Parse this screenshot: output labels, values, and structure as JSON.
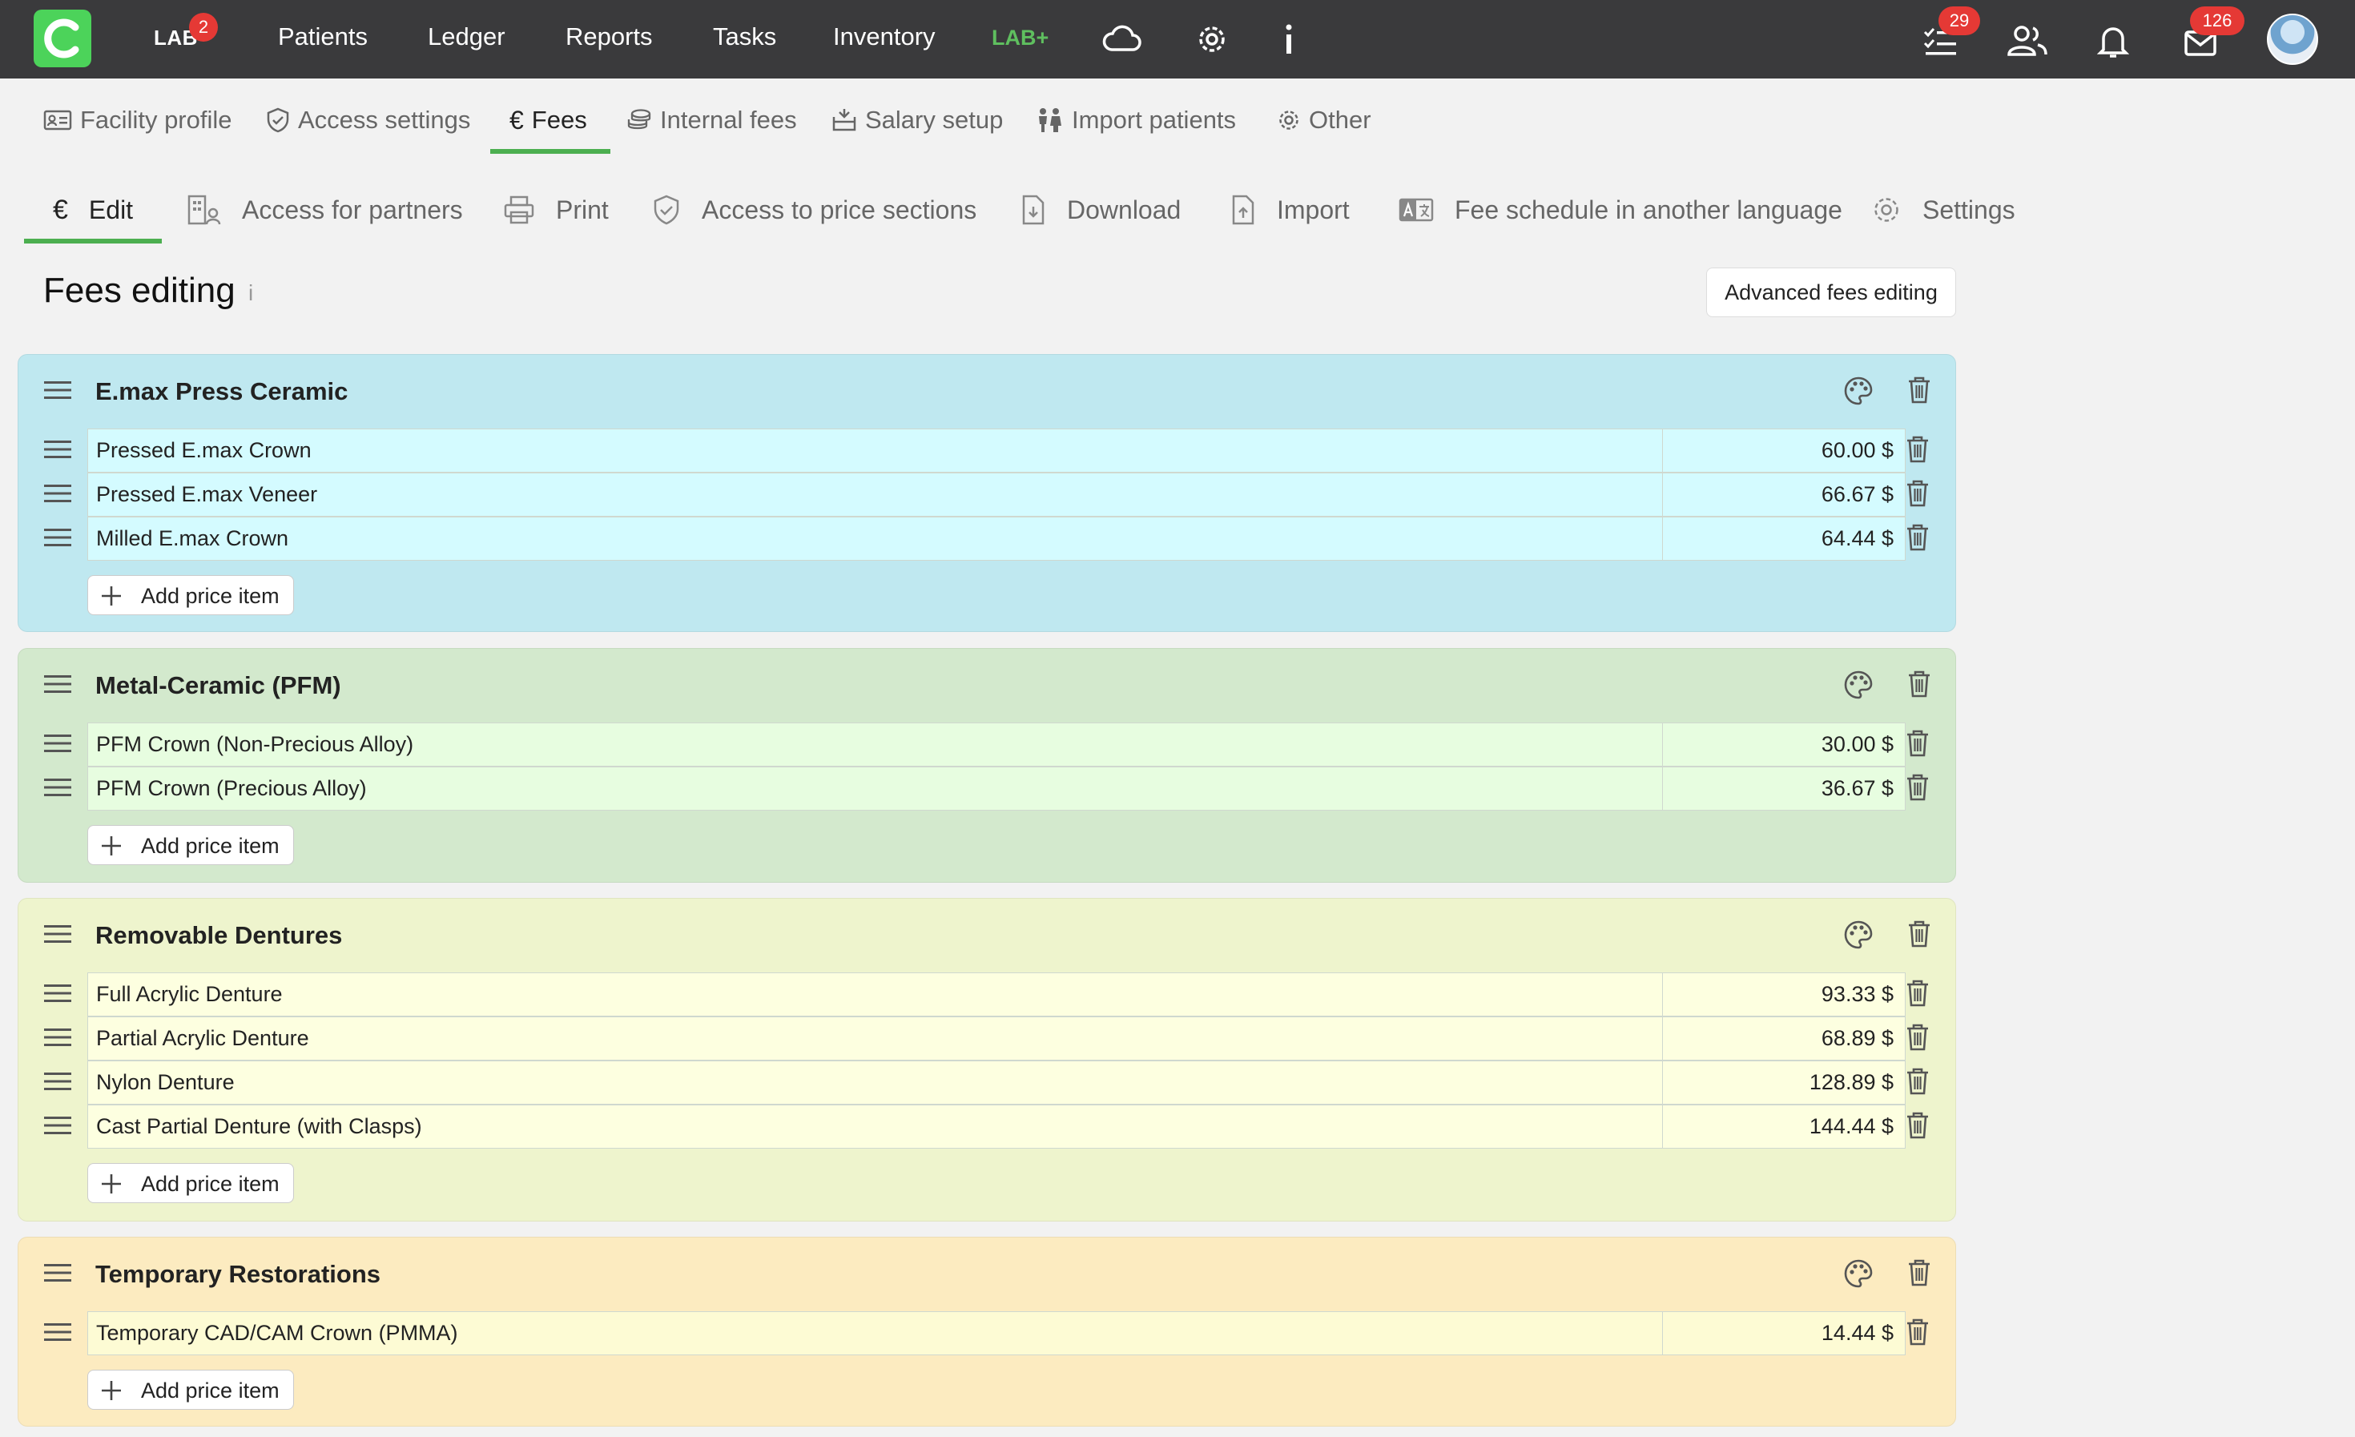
{
  "topbar": {
    "lab_label": "LAB",
    "lab_badge": "2",
    "nav": [
      "Patients",
      "Ledger",
      "Reports",
      "Tasks",
      "Inventory"
    ],
    "labplus": "LAB+",
    "tasks_badge": "29",
    "mail_badge": "126"
  },
  "settings_tabs": [
    {
      "label": "Facility profile",
      "icon": "id-card-icon"
    },
    {
      "label": "Access settings",
      "icon": "shield-icon"
    },
    {
      "label": "Fees",
      "icon": "euro-icon"
    },
    {
      "label": "Internal fees",
      "icon": "coins-icon"
    },
    {
      "label": "Salary setup",
      "icon": "wallet-icon"
    },
    {
      "label": "Import patients",
      "icon": "people-icon"
    },
    {
      "label": "Other",
      "icon": "gear-icon"
    }
  ],
  "fee_tabs": [
    {
      "label": "Edit",
      "icon": "euro-icon"
    },
    {
      "label": "Access for partners",
      "icon": "building-icon"
    },
    {
      "label": "Print",
      "icon": "printer-icon"
    },
    {
      "label": "Access to price sections",
      "icon": "shield-icon"
    },
    {
      "label": "Download",
      "icon": "file-download-icon"
    },
    {
      "label": "Import",
      "icon": "file-upload-icon"
    },
    {
      "label": "Fee schedule in another language",
      "icon": "translate-icon"
    },
    {
      "label": "Settings",
      "icon": "gear-icon"
    }
  ],
  "page": {
    "title": "Fees editing",
    "info": "i",
    "advanced_button": "Advanced fees editing",
    "add_label": "Add price item"
  },
  "sections": [
    {
      "title": "E.max Press Ceramic",
      "color": "#bfe8f0",
      "row_color": "#d4fbff",
      "items": [
        {
          "name": "Pressed E.max Crown",
          "price": "60.00 $"
        },
        {
          "name": "Pressed E.max Veneer",
          "price": "66.67 $"
        },
        {
          "name": "Milled E.max Crown",
          "price": "64.44 $"
        }
      ]
    },
    {
      "title": "Metal-Ceramic (PFM)",
      "color": "#d3e9cd",
      "row_color": "#e7fde0",
      "items": [
        {
          "name": "PFM Crown (Non-Precious Alloy)",
          "price": "30.00 $"
        },
        {
          "name": "PFM Crown (Precious Alloy)",
          "price": "36.67 $"
        }
      ]
    },
    {
      "title": "Removable Dentures",
      "color": "#eef4cd",
      "row_color": "#fdffe0",
      "items": [
        {
          "name": "Full Acrylic Denture",
          "price": "93.33 $"
        },
        {
          "name": "Partial Acrylic Denture",
          "price": "68.89 $"
        },
        {
          "name": "Nylon Denture",
          "price": "128.89 $"
        },
        {
          "name": "Cast Partial Denture (with Clasps)",
          "price": "144.44 $"
        }
      ]
    },
    {
      "title": "Temporary Restorations",
      "color": "#fcebc0",
      "row_color": "#fdfbd4",
      "items": [
        {
          "name": "Temporary CAD/CAM Crown (PMMA)",
          "price": "14.44 $"
        }
      ]
    }
  ]
}
